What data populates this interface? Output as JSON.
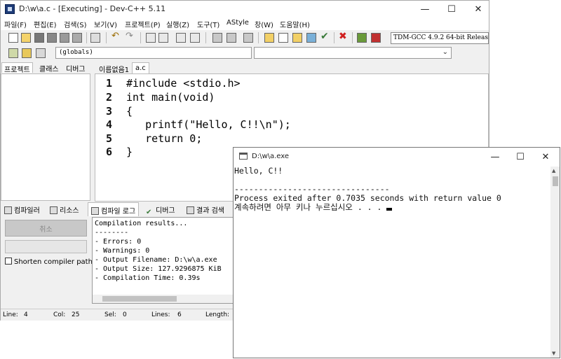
{
  "devcpp": {
    "title": "D:\\w\\a.c - [Executing] - Dev-C++ 5.11",
    "menu": [
      "파일(F)",
      "편집(E)",
      "검색(S)",
      "보기(V)",
      "프로젝트(P)",
      "실행(Z)",
      "도구(T)",
      "AStyle",
      "창(W)",
      "도움말(H)"
    ],
    "compiler": "TDM-GCC 4.9.2 64-bit Release",
    "scope_select": "(globals)",
    "left_tabs": [
      "프로젝트",
      "클래스",
      "디버그"
    ],
    "editor_tabs": [
      "이름없음1",
      "a.c"
    ],
    "code_lines": [
      {
        "num": "1",
        "text": "#include <stdio.h>"
      },
      {
        "num": "2",
        "text": "int main(void)"
      },
      {
        "num": "3",
        "text": "{"
      },
      {
        "num": "4",
        "text": "   printf(\"Hello, C!!\\n\");"
      },
      {
        "num": "5",
        "text": "   return 0;"
      },
      {
        "num": "6",
        "text": "}"
      }
    ],
    "bottom_tabs": [
      "컴파일러",
      "리소스",
      "컴파일 로그",
      "디버그",
      "결과 검색"
    ],
    "abort_label": "취소",
    "shorten_label": "Shorten compiler paths",
    "compile_log": [
      "Compilation results...",
      "--------",
      "- Errors: 0",
      "- Warnings: 0",
      "- Output Filename: D:\\w\\a.exe",
      "- Output Size: 127.9296875 KiB",
      "- Compilation Time: 0.39s"
    ],
    "status": {
      "line_label": "Line:",
      "line_value": "4",
      "col_label": "Col:",
      "col_value": "25",
      "sel_label": "Sel:",
      "sel_value": "0",
      "lines_label": "Lines:",
      "lines_value": "6",
      "length_label": "Length:"
    }
  },
  "console": {
    "title": "D:\\w\\a.exe",
    "lines": [
      "Hello, C!!",
      "",
      "--------------------------------",
      "Process exited after 0.7035 seconds with return value 0",
      "계속하려면 아무 키나 누르십시오 . . . "
    ]
  }
}
